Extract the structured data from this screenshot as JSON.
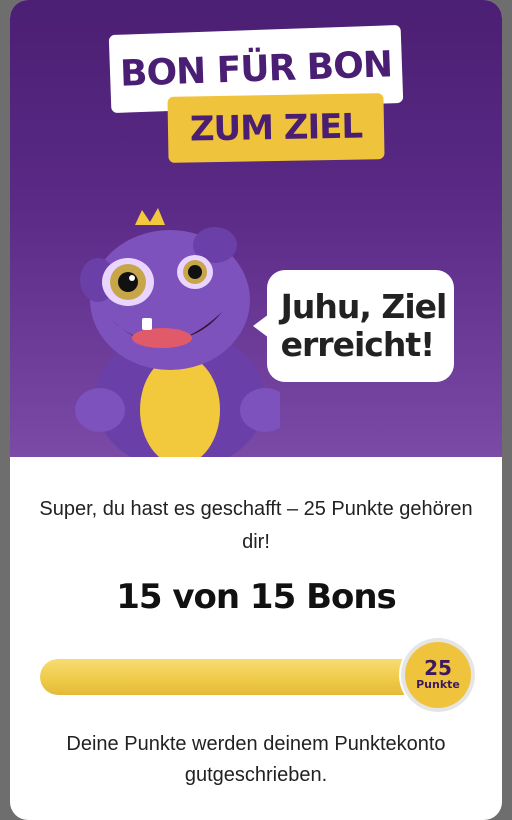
{
  "hero": {
    "title_line1": "BON FÜR BON",
    "title_line2": "ZUM ZIEL",
    "bubble_text": "Juhu, Ziel\nerreicht!"
  },
  "content": {
    "message": "Super, du hast es geschafft – 25 Punkte gehören dir!",
    "count_text": "15 von 15 Bons",
    "progress": {
      "current": 15,
      "total": 15,
      "fraction": 1.0
    },
    "badge": {
      "points": "25",
      "label": "Punkte"
    },
    "footer_text": "Deine Punkte werden deinem Punktekonto gutgeschrieben."
  },
  "colors": {
    "brand_purple": "#4a1e72",
    "accent_yellow": "#f0c33c"
  },
  "icons": {
    "mascot": "purple-dragon-mascot"
  }
}
